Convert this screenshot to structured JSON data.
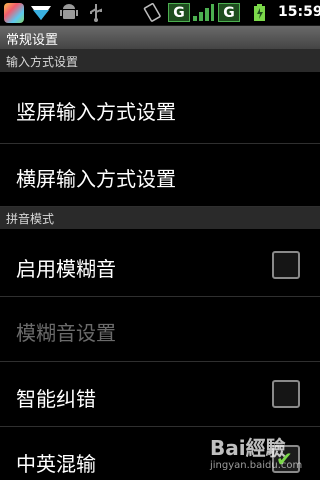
{
  "status_bar": {
    "notification_icons": [
      "app-icon",
      "tidy-app-icon",
      "android-icon",
      "usb-icon"
    ],
    "network_badges": [
      "G",
      "G"
    ],
    "time": "15:59"
  },
  "title_bar": {
    "title": "常规设置"
  },
  "sections": [
    {
      "header": "输入方式设置",
      "items": [
        {
          "label": "竖屏输入方式设置"
        },
        {
          "label": "横屏输入方式设置"
        }
      ]
    },
    {
      "header": "拼音模式",
      "items": [
        {
          "label": "启用模糊音",
          "checked": false
        },
        {
          "label": "模糊音设置",
          "enabled": false
        },
        {
          "label": "智能纠错",
          "checked": false
        },
        {
          "label": "中英混输",
          "checked": true
        }
      ]
    }
  ],
  "watermark": {
    "logo": "Bai經驗",
    "url": "jingyan.baidu.com"
  },
  "colors": {
    "background": "#000000",
    "section_bg": "#2a2a2a",
    "disabled_text": "#6b6b6b",
    "check_green": "#7bd84a"
  }
}
